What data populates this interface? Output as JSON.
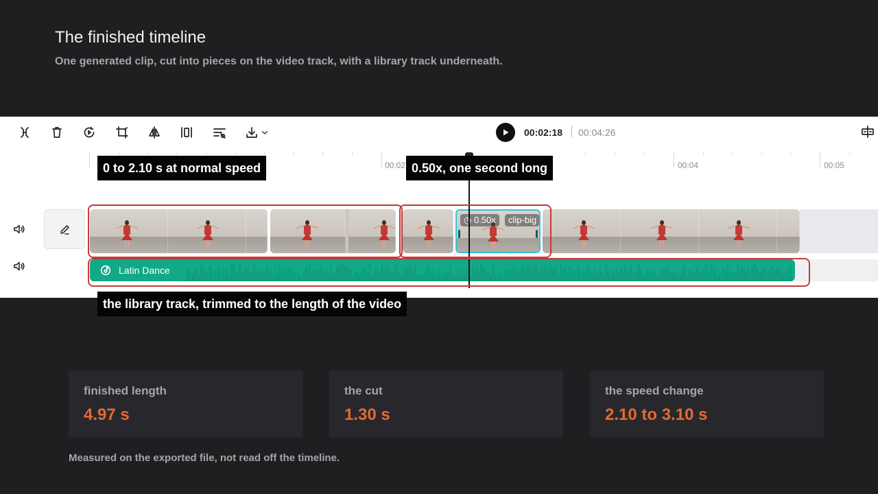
{
  "page": {
    "title": "The finished timeline",
    "subtitle": "One generated clip, cut into pieces on the video track, with a library track underneath."
  },
  "toolbar": {
    "tools": [
      "split-icon",
      "delete-icon",
      "speed-icon",
      "crop-icon",
      "flip-icon",
      "freeze-icon",
      "adjust-icon",
      "download-icon",
      "dropdown-chevron-icon"
    ],
    "current_time": "00:02:18",
    "total_time": "00:04:26",
    "right_tool": "fit-timeline-icon"
  },
  "ruler": {
    "labels": [
      "00:02",
      "00:04",
      "00:05"
    ]
  },
  "video_track": {
    "selected_clip": {
      "speed_label": "0.50x",
      "name_label": "clip-big"
    }
  },
  "audio_track": {
    "name": "Latin Dance"
  },
  "callouts": {
    "first_segment": "0 to 2.10 s at normal speed",
    "slow_segment": "0.50x, one second long",
    "library_track": "the library track, trimmed to the length of the video"
  },
  "stats": [
    {
      "label": "finished length",
      "value": "4.97 s"
    },
    {
      "label": "the cut",
      "value": "1.30 s"
    },
    {
      "label": "the speed change",
      "value": "2.10 to 3.10 s"
    }
  ],
  "footnote": "Measured on the exported file, not read off the timeline.",
  "colors": {
    "background": "#1f1f22",
    "accent_value": "#e36a32",
    "audio_clip": "#12a888",
    "selected_clip_border": "#32c5de",
    "annotation_frame": "#c33a3a"
  }
}
